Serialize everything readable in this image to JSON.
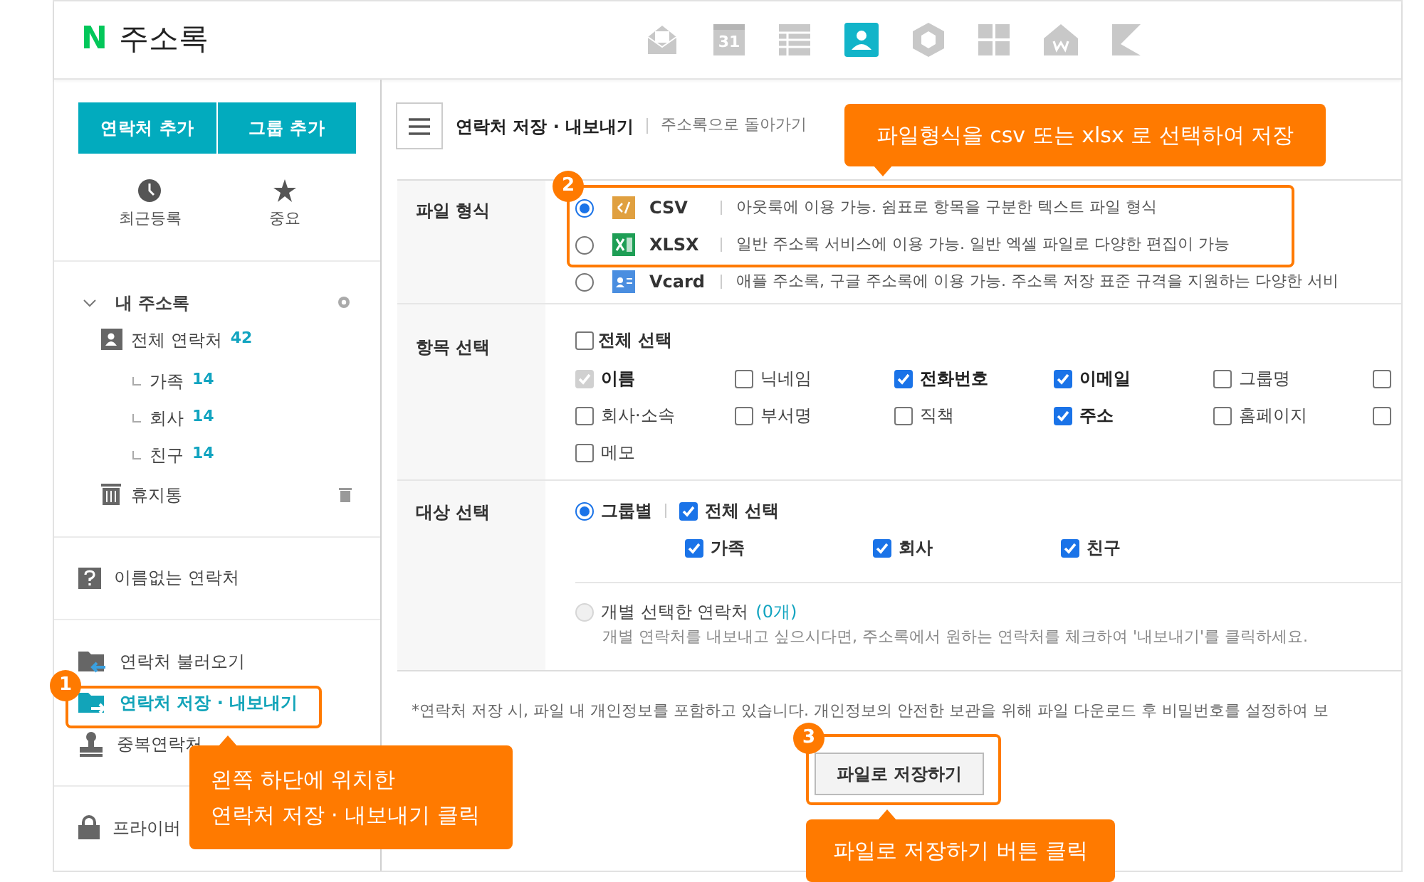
{
  "header": {
    "logo": "N",
    "title": "주소록",
    "apps": [
      {
        "kind": "mail",
        "selected": false
      },
      {
        "kind": "calendar",
        "label": "31",
        "selected": false
      },
      {
        "kind": "table",
        "selected": false
      },
      {
        "kind": "contacts",
        "selected": true
      },
      {
        "kind": "box",
        "selected": false
      },
      {
        "kind": "grid",
        "selected": false
      },
      {
        "kind": "house",
        "selected": false
      },
      {
        "kind": "flag",
        "selected": false
      }
    ]
  },
  "sidebar": {
    "buttons": [
      "연락처 추가",
      "그룹 추가"
    ],
    "quick": [
      {
        "kind": "clock",
        "label": "최근등록"
      },
      {
        "kind": "star",
        "label": "중요"
      }
    ],
    "tree": {
      "label": "내 주소록",
      "expanded": true,
      "children": [
        {
          "label": "전체 연락처",
          "count": "42",
          "children": [
            {
              "label": "가족",
              "count": "14"
            },
            {
              "label": "회사",
              "count": "14"
            },
            {
              "label": "친구",
              "count": "14"
            }
          ]
        }
      ]
    },
    "trash": "휴지통",
    "unnamed": "이름없는 연락처",
    "tools": [
      {
        "kind": "import",
        "label": "연락처 불러오기",
        "selected": false
      },
      {
        "kind": "export",
        "label": "연락처 저장 · 내보내기",
        "selected": true
      },
      {
        "kind": "stamp",
        "label": "중복연락처",
        "selected": false
      }
    ],
    "privacy": "프라이버"
  },
  "main": {
    "title": "연락처 저장 · 내보내기",
    "back_link": "주소록으로 돌아가기",
    "format": {
      "label": "파일 형식",
      "options": [
        {
          "kind": "csv",
          "name": "CSV",
          "description": "아웃룩에 이용 가능. 쉼표로 항목을 구분한 텍스트 파일 형식",
          "selected": true
        },
        {
          "kind": "xlsx",
          "name": "XLSX",
          "description": "일반 주소록 서비스에 이용 가능. 일반 엑셀 파일로 다양한 편집이 가능",
          "selected": false
        },
        {
          "kind": "vcard",
          "name": "Vcard",
          "description": "애플 주소록, 구글 주소록에 이용 가능. 주소록 저장 표준 규격을 지원하는 다양한 서비",
          "selected": false
        }
      ]
    },
    "fields": {
      "label": "항목 선택",
      "select_all": {
        "label": "전체 선택",
        "checked": false
      },
      "items": [
        {
          "label": "이름",
          "checked": true,
          "disabled": true
        },
        {
          "label": "닉네임",
          "checked": false,
          "disabled": false
        },
        {
          "label": "전화번호",
          "checked": true,
          "disabled": false
        },
        {
          "label": "이메일",
          "checked": true,
          "disabled": false
        },
        {
          "label": "그룹명",
          "checked": false,
          "disabled": false
        },
        {
          "checked": false,
          "disabled": false
        },
        {
          "label": "회사·소속",
          "checked": false,
          "disabled": false
        },
        {
          "label": "부서명",
          "checked": false,
          "disabled": false
        },
        {
          "label": "직책",
          "checked": false,
          "disabled": false
        },
        {
          "label": "주소",
          "checked": true,
          "disabled": false
        },
        {
          "label": "홈페이지",
          "checked": false,
          "disabled": false
        },
        {
          "checked": false,
          "disabled": false
        },
        {
          "label": "메모",
          "checked": false,
          "disabled": false
        }
      ]
    },
    "target": {
      "label": "대상 선택",
      "by_group": {
        "label": "그룹별",
        "selected": true
      },
      "select_all": {
        "label": "전체 선택",
        "checked": true
      },
      "groups": [
        {
          "label": "가족",
          "checked": true
        },
        {
          "label": "회사",
          "checked": true
        },
        {
          "label": "친구",
          "checked": true
        }
      ],
      "individual": {
        "label": "개별 선택한 연락처",
        "count": "(0개)",
        "selected": false,
        "disabled": true,
        "hint": "개별 연락처를 내보내고 싶으시다면, 주소록에서 원하는 연락처를 체크하여 '내보내기'를 클릭하세요."
      }
    },
    "footnote": "*연락처 저장 시, 파일 내 개인정보를 포함하고 있습니다. 개인정보의 안전한 보관을 위해 파일 다운로드 후 비밀번호를 설정하여 보",
    "save_button": "파일로 저장하기"
  },
  "callouts": [
    {
      "number": "1",
      "text": "왼쪽 하단에 위치한\n연락처 저장 · 내보내기 클릭"
    },
    {
      "number": "2",
      "text": "파일형식을 csv 또는 xlsx 로 선택하여 저장"
    },
    {
      "number": "3",
      "text": "파일로 저장하기 버튼 클릭"
    }
  ]
}
